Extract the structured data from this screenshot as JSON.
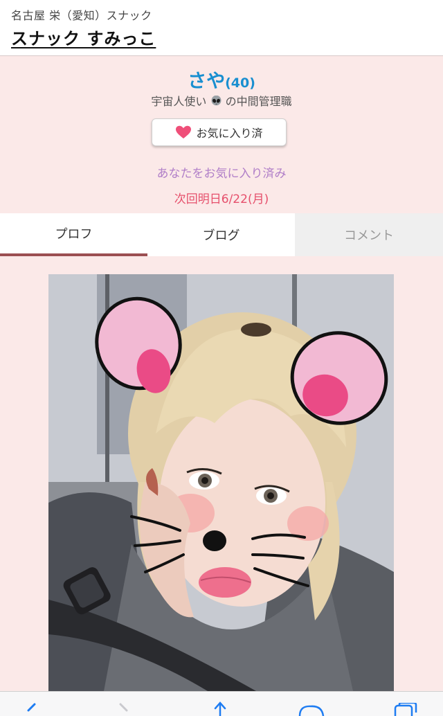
{
  "header": {
    "breadcrumb": "名古屋 栄（愛知）スナック",
    "shop_name": "スナック すみっこ"
  },
  "profile": {
    "name": "さや",
    "age": "(40)",
    "tagline_before": "宇宙人使い",
    "tagline_after": "の中間管理職",
    "favorite_button_label": "お気に入り済",
    "favorite_status": "あなたをお気に入り済み",
    "next_visit": "次回明日6/22(月)"
  },
  "tabs": [
    {
      "label": "プロフ",
      "active": true
    },
    {
      "label": "ブログ",
      "active": false
    },
    {
      "label": "コメント",
      "active": false,
      "disabled": true
    }
  ],
  "colors": {
    "accent_blue": "#1a8fd0",
    "pink_background": "#fbe9e8",
    "heart": "#ef4f79",
    "tab_underline": "#9b4f52",
    "ios_blue": "#1e7cf2"
  },
  "toolbar": {
    "icons": [
      "back-icon",
      "forward-icon",
      "share-icon",
      "bookmarks-icon",
      "tabs-icon"
    ]
  }
}
